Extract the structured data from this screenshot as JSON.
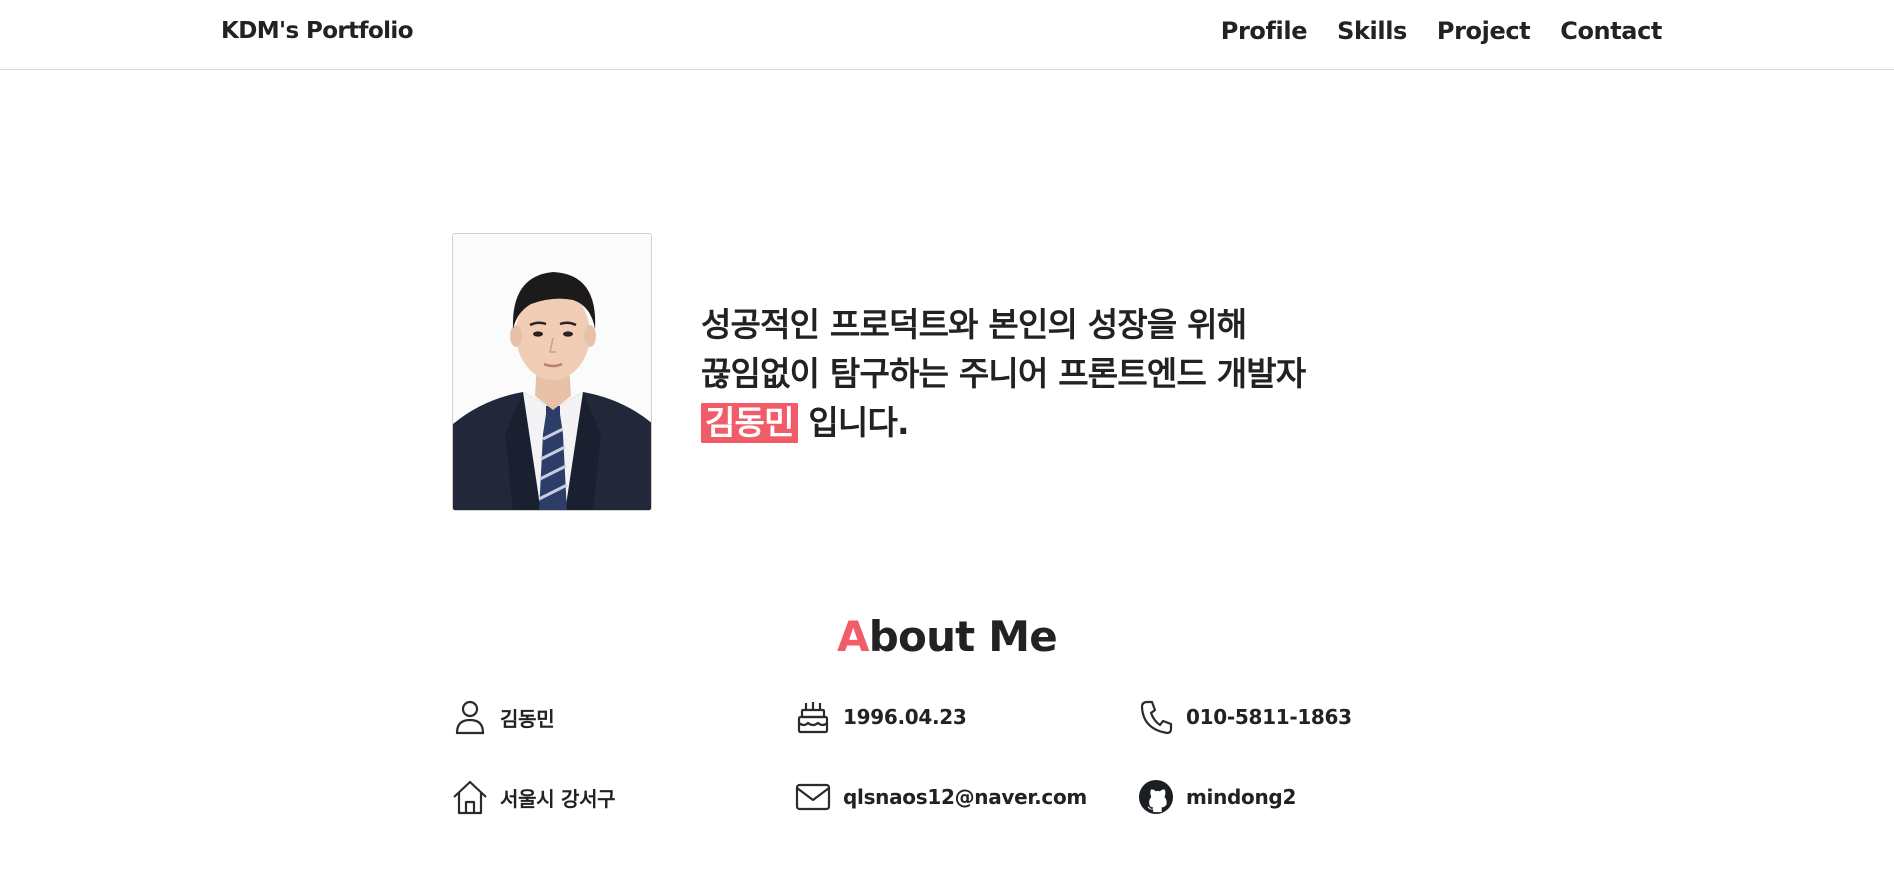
{
  "header": {
    "brand": "KDM's Portfolio",
    "nav": [
      "Profile",
      "Skills",
      "Project",
      "Contact"
    ]
  },
  "hero": {
    "line1": "성공적인 프로덕트와 본인의 성장을 위해",
    "line2": "끊임없이 탐구하는 주니어 프론트엔드 개발자",
    "name_highlight": "김동민",
    "line3_suffix": " 입니다."
  },
  "about": {
    "title_accent": "A",
    "title_rest": "bout Me",
    "items": [
      {
        "icon": "person-icon",
        "text": "김동민"
      },
      {
        "icon": "cake-icon",
        "text": "1996.04.23"
      },
      {
        "icon": "phone-icon",
        "text": "010-5811-1863"
      },
      {
        "icon": "home-icon",
        "text": "서울시 강서구"
      },
      {
        "icon": "mail-icon",
        "text": "qlsnaos12@naver.com"
      },
      {
        "icon": "github-icon",
        "text": "mindong2"
      }
    ]
  },
  "colors": {
    "accent": "#f25c69",
    "text": "#222222"
  }
}
